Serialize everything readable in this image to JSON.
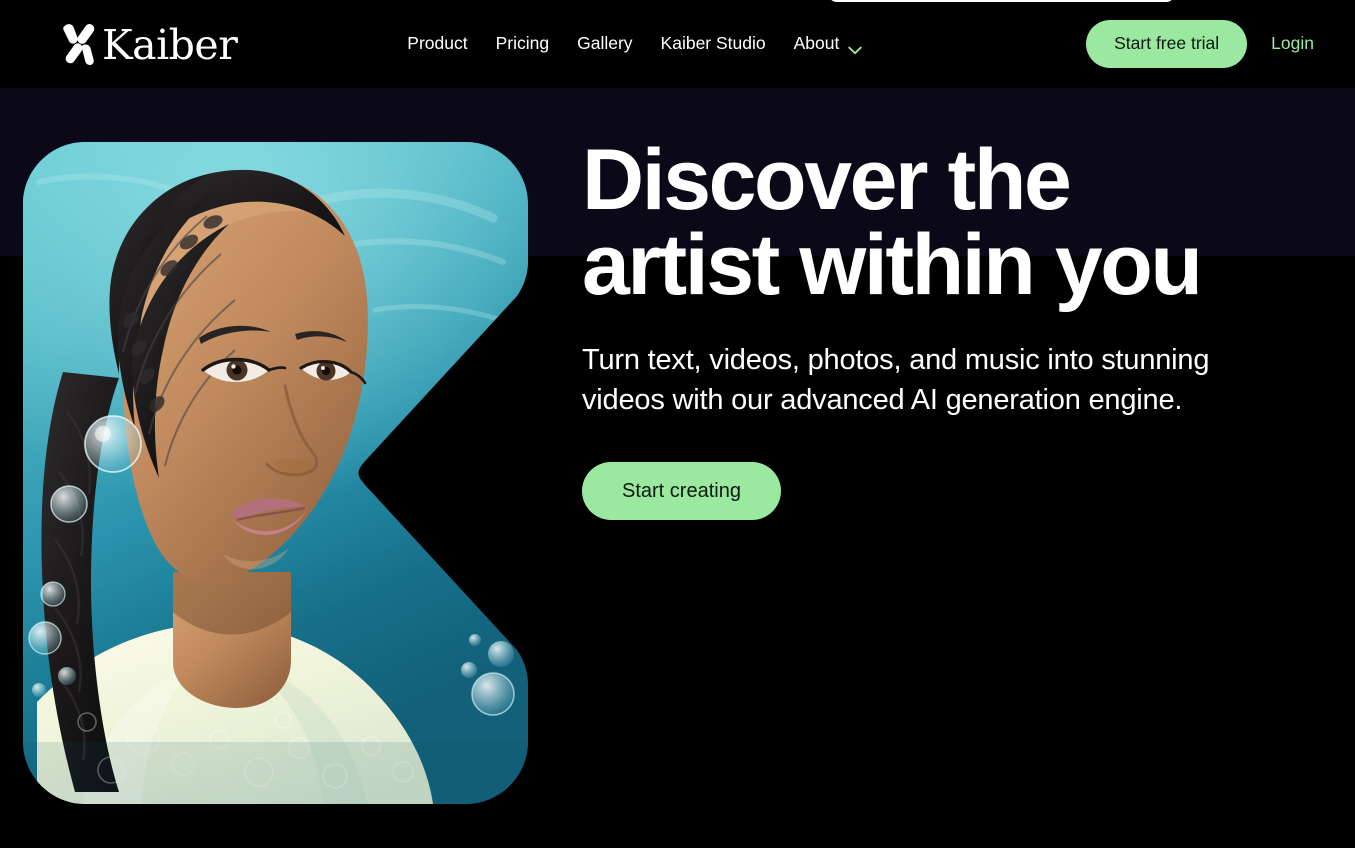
{
  "brand": {
    "mark_icon": "kaiber-k-mark-icon",
    "wordmark": "Kaiber"
  },
  "nav": {
    "items": [
      {
        "label": "Product",
        "has_chevron": false
      },
      {
        "label": "Pricing",
        "has_chevron": false
      },
      {
        "label": "Gallery",
        "has_chevron": false
      },
      {
        "label": "Kaiber Studio",
        "has_chevron": false
      },
      {
        "label": "About",
        "has_chevron": true,
        "chevron_icon": "chevron-down-icon"
      }
    ]
  },
  "header_actions": {
    "trial_label": "Start free trial",
    "login_label": "Login"
  },
  "hero": {
    "title_line1": "Discover the",
    "title_line2": "artist within you",
    "subtitle": "Turn text, videos, photos, and music into stunning videos with our advanced AI generation engine.",
    "cta_label": "Start creating",
    "image_alt": "Portrait of a woman with braided hair underwater surrounded by bubbles"
  },
  "colors": {
    "accent_green": "#9be8a0",
    "page_background": "#000000",
    "band_background": "#0b0818",
    "text_primary": "#ffffff",
    "image_water_light": "#4fb8c6",
    "image_water_deep": "#14687f",
    "image_skin": "#c08a5e",
    "image_garment": "#eef3d8"
  }
}
